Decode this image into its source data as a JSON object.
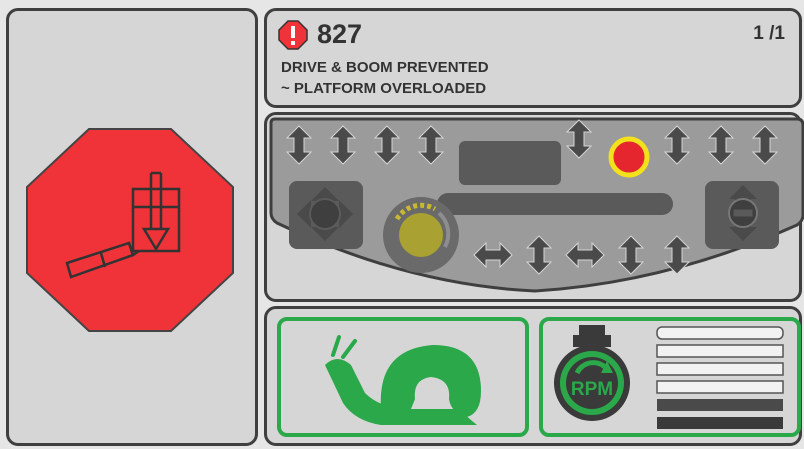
{
  "fault": {
    "code": "827",
    "page": "1 /1",
    "line1": "DRIVE & BOOM PREVENTED",
    "line2": "~ PLATFORM OVERLOADED"
  },
  "icons": {
    "fault_alert": "exclamation-octagon-icon",
    "platform_overload": "platform-overload-octagon-icon",
    "speed": "snail-icon",
    "rpm": "engine-rpm-icon"
  },
  "rpm": {
    "label": "RPM",
    "level_bars_filled": 2,
    "level_bars_total": 6
  },
  "colors": {
    "alert_red": "#ef3338",
    "indicator_red": "#e6262f",
    "indicator_ring": "#f3e21b",
    "speed_green": "#2aa84a",
    "panel_border": "#3f3f3f",
    "control_dark": "#4a4a4a"
  }
}
